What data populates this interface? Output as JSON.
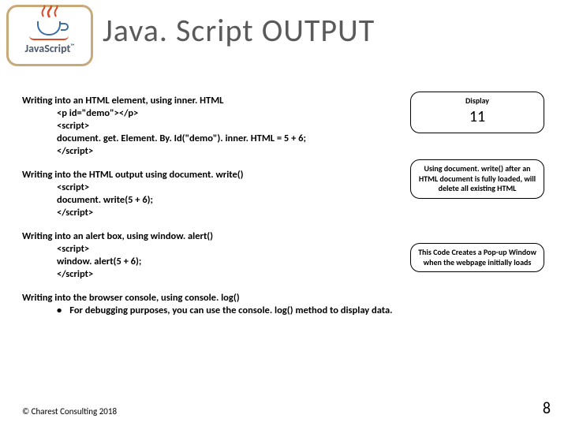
{
  "logo": {
    "text": "JavaScript",
    "tm": "™"
  },
  "title": "Java. Script OUTPUT",
  "sections": {
    "s1": {
      "heading": "Writing into an HTML element, using inner. HTML",
      "l1": "<p id=\"demo\"></p>",
      "l2": "<script>",
      "l3": "document. get. Element. By. Id(\"demo\"). inner. HTML = 5 + 6;",
      "l4": "</script>"
    },
    "s2": {
      "heading": "Writing into the HTML output using document. write()",
      "l1": "<script>",
      "l2": "document. write(5 + 6);",
      "l3": "</script>"
    },
    "s3": {
      "heading": "Writing into an alert box, using window. alert()",
      "l1": "<script>",
      "l2": "window. alert(5 + 6);",
      "l3": "</script>"
    },
    "s4": {
      "heading": "Writing into the browser console, using console. log()",
      "bullet": "•",
      "sub": "For debugging purposes, you can use the console. log() method to display data."
    }
  },
  "callouts": {
    "c1": {
      "label": "Display",
      "value": "11"
    },
    "c2": "Using document. write() after an HTML document is fully loaded, will delete all existing HTML",
    "c3": "This Code Creates a Pop-up Window when the webpage initially loads"
  },
  "footer": "© Charest Consulting 2018",
  "page": "8"
}
